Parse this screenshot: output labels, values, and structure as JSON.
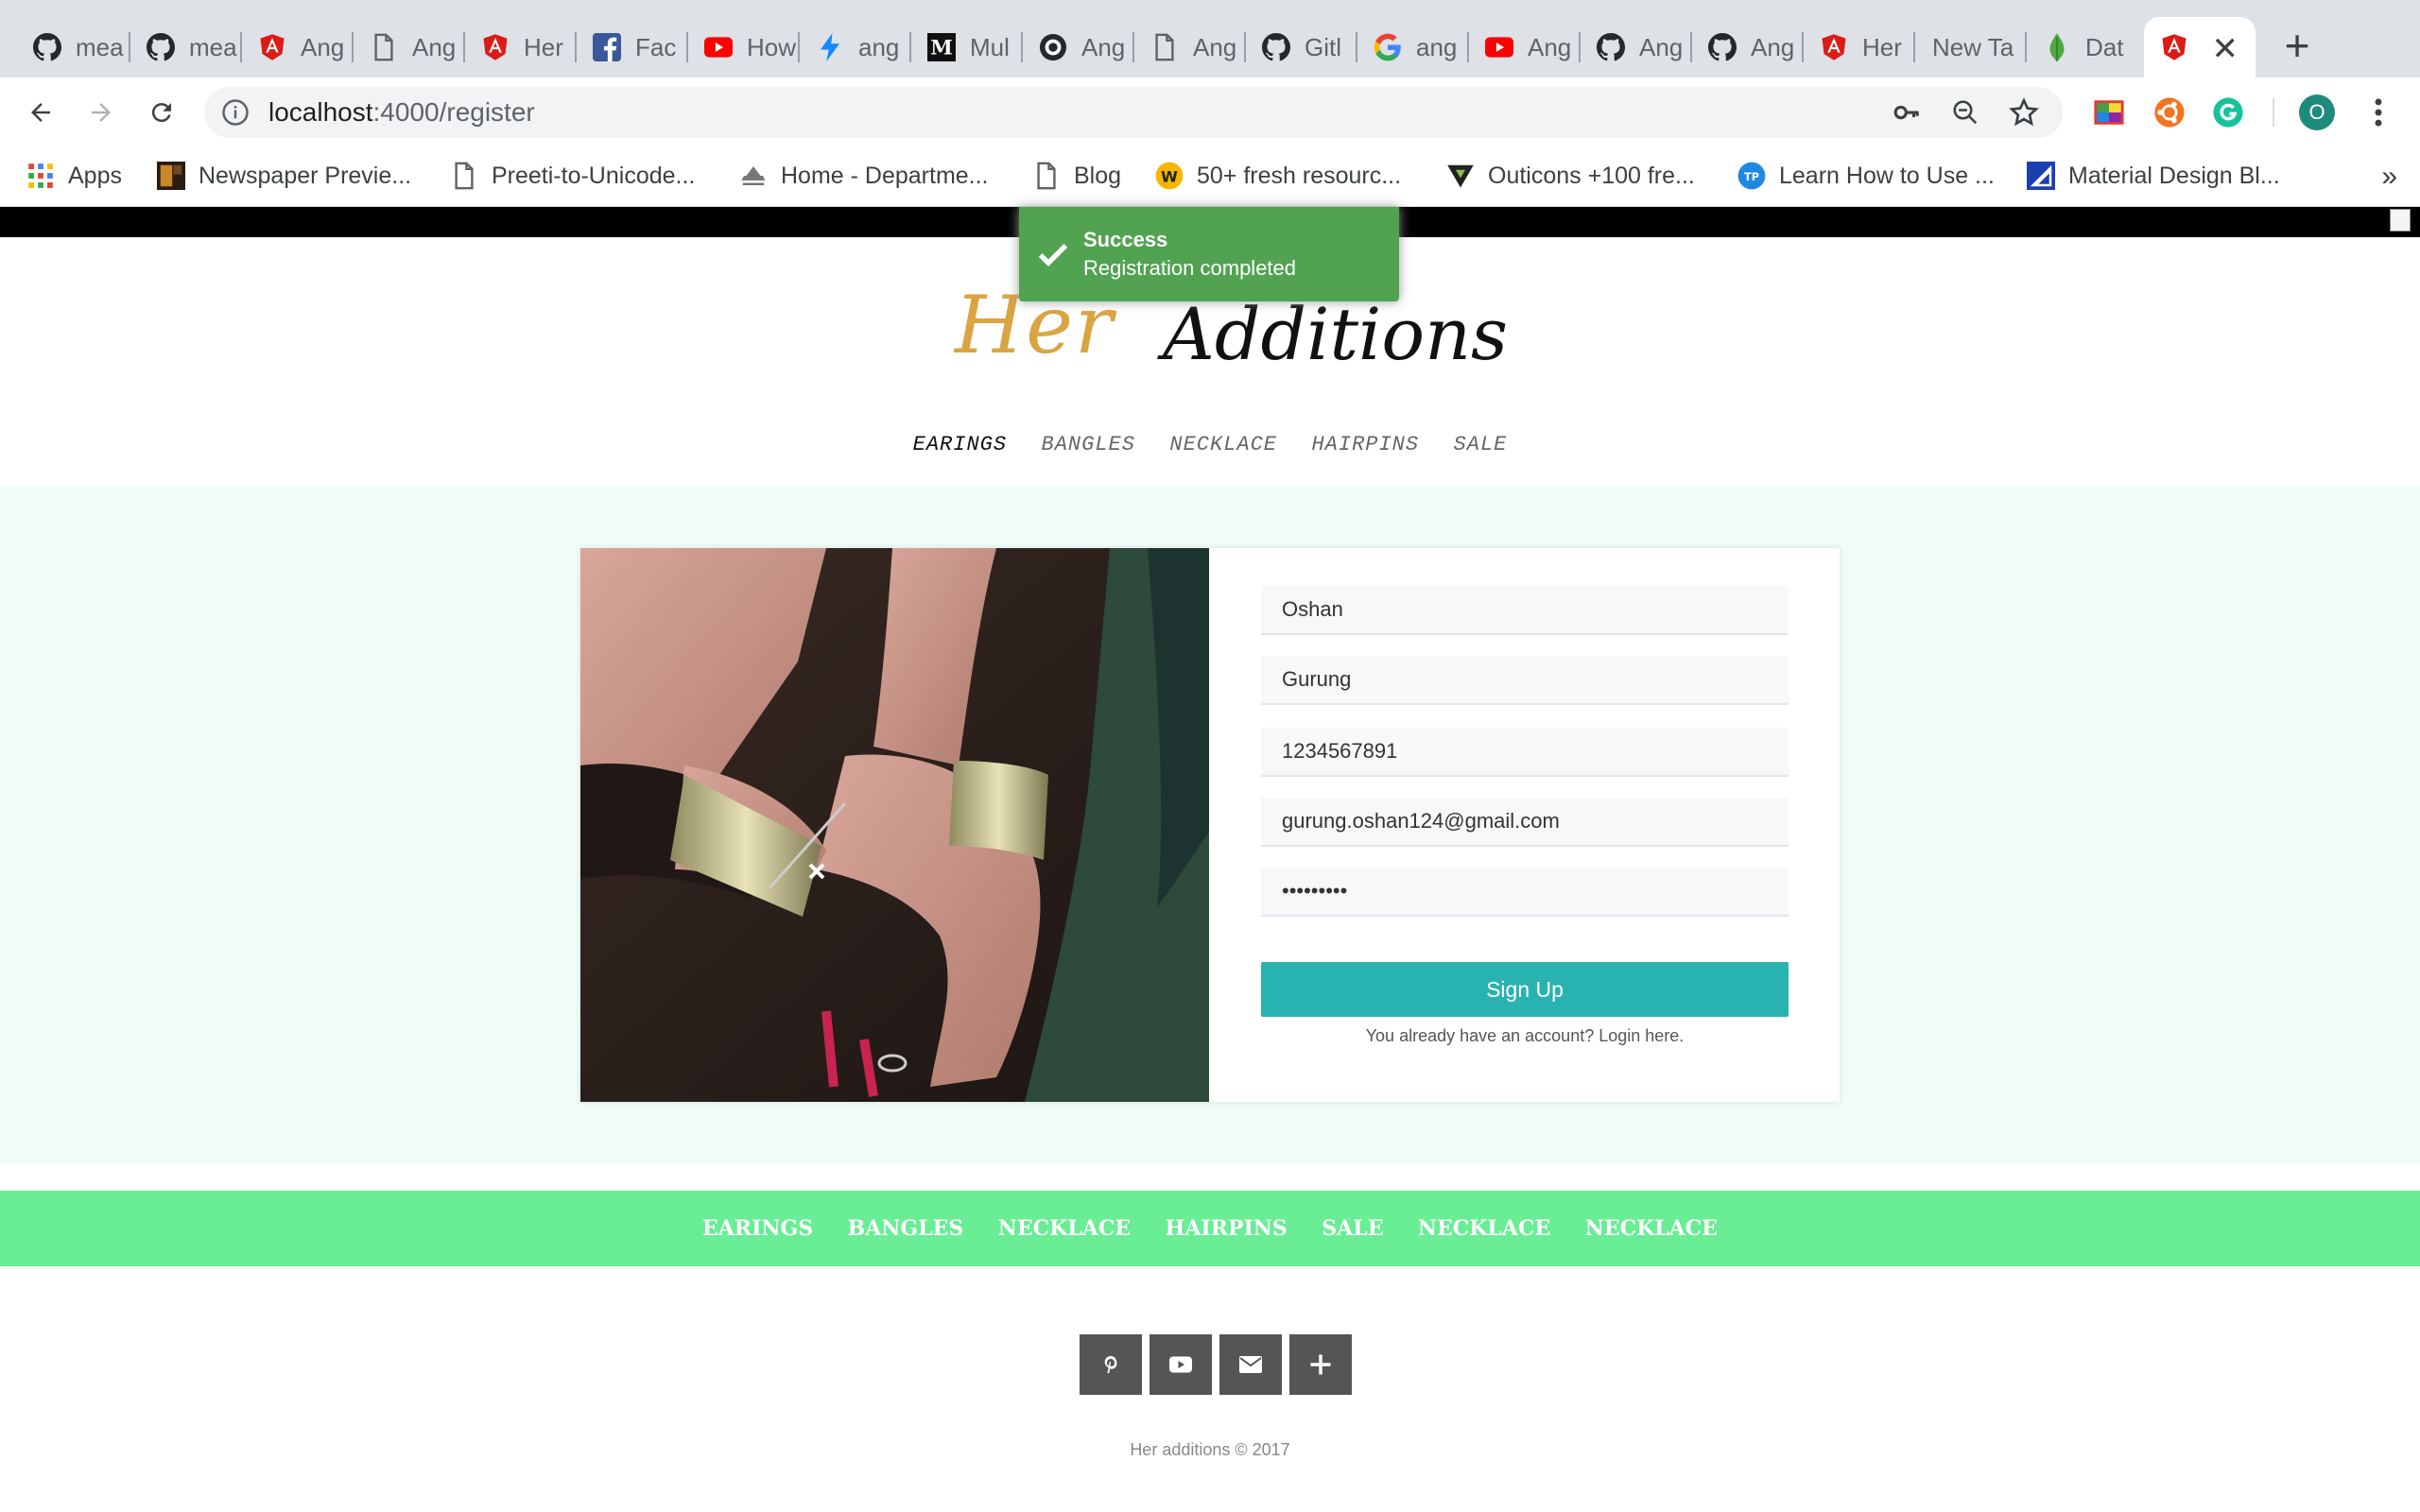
{
  "browser": {
    "tabs": [
      {
        "label": "mea",
        "icon": "github-icon"
      },
      {
        "label": "mea",
        "icon": "github-icon"
      },
      {
        "label": "Ang",
        "icon": "angular-icon"
      },
      {
        "label": "Ang",
        "icon": "page-icon"
      },
      {
        "label": "Her",
        "icon": "angular-icon"
      },
      {
        "label": "Fac",
        "icon": "facebook-icon"
      },
      {
        "label": "How",
        "icon": "youtube-icon"
      },
      {
        "label": "ang",
        "icon": "bolt-icon"
      },
      {
        "label": "Mul",
        "icon": "medium-icon"
      },
      {
        "label": "Ang",
        "icon": "github-icon"
      },
      {
        "label": "Ang",
        "icon": "page-icon"
      },
      {
        "label": "Gitl",
        "icon": "github-icon"
      },
      {
        "label": "ang",
        "icon": "google-icon"
      },
      {
        "label": "Ang",
        "icon": "youtube-icon"
      },
      {
        "label": "Ang",
        "icon": "github-icon"
      },
      {
        "label": "Ang",
        "icon": "github-icon"
      },
      {
        "label": "Her",
        "icon": "angular-icon"
      },
      {
        "label": "New Ta",
        "icon": ""
      },
      {
        "label": "Dat",
        "icon": "leaf-icon"
      }
    ],
    "active_tab": {
      "label": "",
      "icon": "angular-icon"
    },
    "url": {
      "host": "localhost",
      "path": ":4000/register"
    },
    "profile_initial": "O",
    "bookmarks": [
      {
        "label": "Apps",
        "icon": "apps-grid-icon"
      },
      {
        "label": "Newspaper Previe...",
        "icon": "newspaper-icon"
      },
      {
        "label": "Preeti-to-Unicode...",
        "icon": "page-icon"
      },
      {
        "label": "Home - Departme...",
        "icon": "emblem-icon"
      },
      {
        "label": "Blog",
        "icon": "page-icon"
      },
      {
        "label": "50+ fresh resourc...",
        "icon": "w-badge-icon"
      },
      {
        "label": "Outicons +100 fre...",
        "icon": "outicons-icon"
      },
      {
        "label": "Learn How to Use ...",
        "icon": "tp-icon"
      },
      {
        "label": "Material Design Bl...",
        "icon": "material-icon"
      }
    ],
    "bookmarks_more": "»"
  },
  "toast": {
    "title": "Success",
    "message": "Registration completed",
    "color": "#51a351"
  },
  "brand": {
    "part1": "Her",
    "part2": "Additions"
  },
  "nav": [
    "EARINGS",
    "BANGLES",
    "NECKLACE",
    "HAIRPINS",
    "SALE"
  ],
  "form": {
    "first_name": "Oshan",
    "last_name": "Gurung",
    "phone": "1234567891",
    "email": "gurung.oshan124@gmail.com",
    "password": "•••••••••",
    "submit_label": "Sign Up",
    "login_text": "You already have an account? Login here."
  },
  "footer": {
    "nav": [
      "EARINGS",
      "BANGLES",
      "NECKLACE",
      "HAIRPINS",
      "SALE",
      "NECKLACE",
      "NECKLACE"
    ],
    "social": [
      "pinterest-icon",
      "youtube-icon",
      "mail-icon",
      "plus-icon"
    ],
    "copyright": "Her additions © 2017"
  },
  "colors": {
    "accent": "#29b3b0",
    "footer_nav": "#69ed95",
    "content_bg": "#f1fcf9",
    "gold": "#d9a441"
  }
}
